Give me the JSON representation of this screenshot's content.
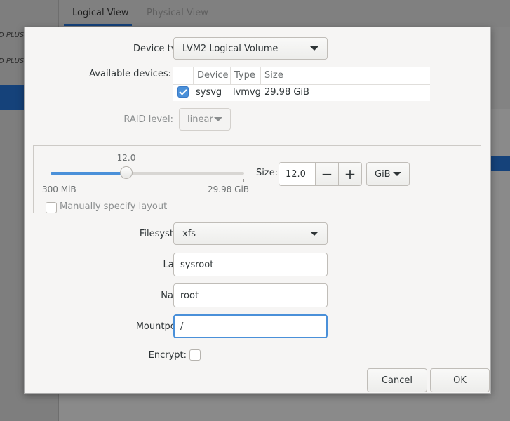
{
  "background": {
    "sidebar_items": [
      "D PLUS",
      "D PLUS"
    ],
    "tabs": [
      "Logical View",
      "Physical View"
    ]
  },
  "dialog": {
    "device_type": {
      "label": "Device type:",
      "value": "LVM2 Logical Volume"
    },
    "available_devices": {
      "label": "Available devices:",
      "columns": [
        "Device",
        "Type",
        "Size"
      ],
      "rows": [
        {
          "checked": true,
          "device": "sysvg",
          "type": "lvmvg",
          "size": "29.98 GiB"
        }
      ]
    },
    "raid_level": {
      "label": "RAID level:",
      "value": "linear"
    },
    "size": {
      "slider_value": "12.0",
      "min_label": "300 MiB",
      "max_label": "29.98 GiB",
      "fraction": 0.39,
      "label": "Size:",
      "value": "12.0",
      "unit": "GiB",
      "minus": "−",
      "plus": "+",
      "manual_layout_label": "Manually specify layout",
      "manual_layout_checked": false
    },
    "filesystem": {
      "label": "Filesystem:",
      "value": "xfs"
    },
    "label_field": {
      "label": "Label:",
      "value": "sysroot"
    },
    "name_field": {
      "label": "Name:",
      "value": "root"
    },
    "mountpoint": {
      "label": "Mountpoint:",
      "value": "/"
    },
    "encrypt": {
      "label": "Encrypt:",
      "checked": false
    },
    "buttons": {
      "cancel": "Cancel",
      "ok": "OK"
    }
  },
  "colors": {
    "accent": "#4a90d9",
    "selection": "#15427a"
  }
}
